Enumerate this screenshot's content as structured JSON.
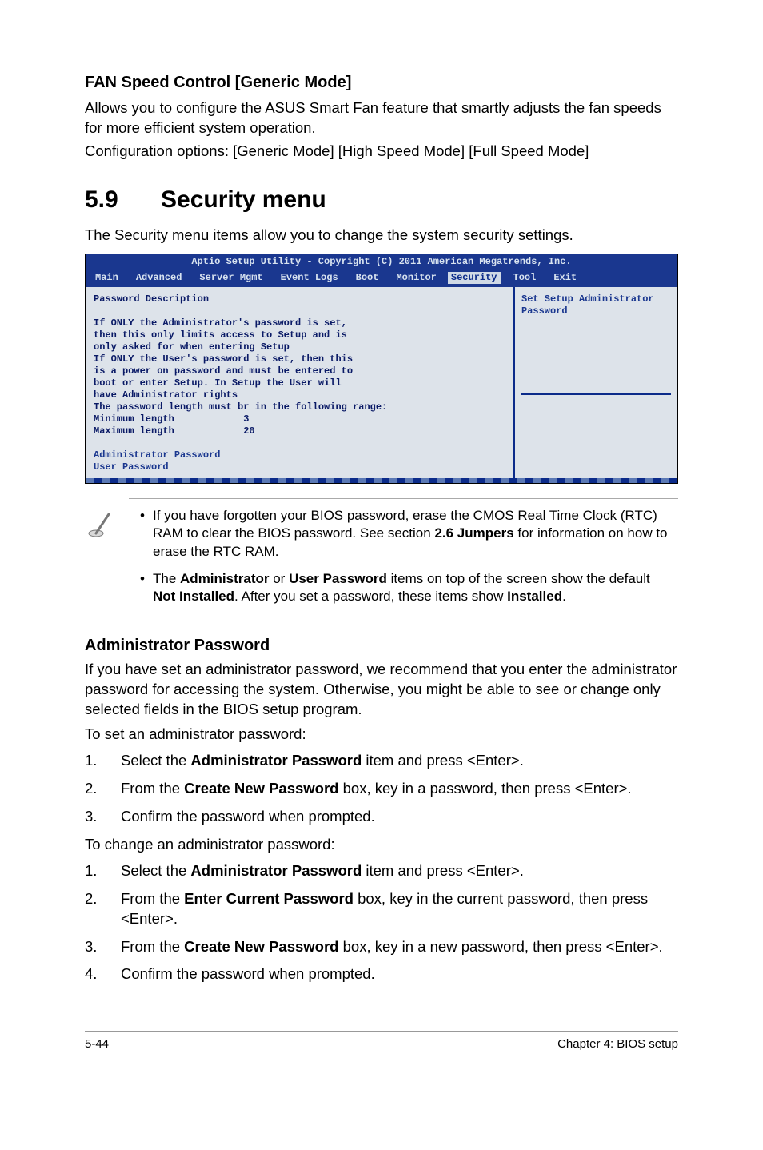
{
  "fan": {
    "heading": "FAN Speed Control [Generic Mode]",
    "p1": "Allows you to configure the ASUS Smart Fan feature that smartly adjusts the fan speeds for more efficient system operation.",
    "p2": "Configuration options: [Generic Mode] [High Speed Mode] [Full Speed Mode]"
  },
  "section": {
    "num": "5.9",
    "title": "Security menu",
    "intro": "The Security menu items allow you to change the system security settings."
  },
  "bios": {
    "title": "Aptio Setup Utility - Copyright (C) 2011 American Megatrends, Inc.",
    "tabs": {
      "main": "Main",
      "advanced": "Advanced",
      "server_mgmt": "Server Mgmt",
      "event_logs": "Event Logs",
      "boot": "Boot",
      "monitor": "Monitor",
      "security": "Security",
      "tool": "Tool",
      "exit": "Exit"
    },
    "left_heading": "Password Description",
    "left_text": "If ONLY the Administrator's password is set,\nthen this only limits access to Setup and is\nonly asked for when entering Setup\nIf ONLY the User's password is set, then this\nis a power on password and must be entered to\nboot or enter Setup. In Setup the User will\nhave Administrator rights\nThe password length must br in the following range:\nMinimum length            3\nMaximum length            20",
    "options": {
      "admin": "Administrator Password",
      "user": "User Password"
    },
    "right": "Set Setup Administrator Password"
  },
  "notes": {
    "n1_a": "If you have forgotten your BIOS password, erase the CMOS Real Time Clock (RTC) RAM to clear the BIOS password. See section ",
    "n1_b": "2.6 Jumpers",
    "n1_c": " for information on how to erase the RTC RAM.",
    "n2_a": "The ",
    "n2_b": "Administrator",
    "n2_c": " or ",
    "n2_d": "User Password",
    "n2_e": " items on top of the screen show the default ",
    "n2_f": "Not Installed",
    "n2_g": ". After you set a password, these items show ",
    "n2_h": "Installed",
    "n2_i": "."
  },
  "admin": {
    "heading": "Administrator Password",
    "intro": "If you have set an administrator password, we recommend that you enter the administrator password for accessing the system. Otherwise, you might be able to see or change only selected fields in the BIOS setup program.",
    "set_lead": "To set an administrator password:",
    "set_steps": {
      "s1_a": "Select the ",
      "s1_b": "Administrator Password",
      "s1_c": " item and press <Enter>.",
      "s2_a": "From the ",
      "s2_b": "Create New Password",
      "s2_c": " box, key in a password, then press <Enter>.",
      "s3": "Confirm the password when prompted."
    },
    "change_lead": "To change an administrator password:",
    "change_steps": {
      "c1_a": "Select the ",
      "c1_b": "Administrator Password",
      "c1_c": " item and press <Enter>.",
      "c2_a": "From the ",
      "c2_b": "Enter Current Password",
      "c2_c": " box, key in the current password, then press <Enter>.",
      "c3_a": "From the ",
      "c3_b": "Create New Password",
      "c3_c": " box, key in a new password, then press <Enter>.",
      "c4": "Confirm the password when prompted."
    }
  },
  "footer": {
    "left": "5-44",
    "right": "Chapter 4: BIOS setup"
  }
}
